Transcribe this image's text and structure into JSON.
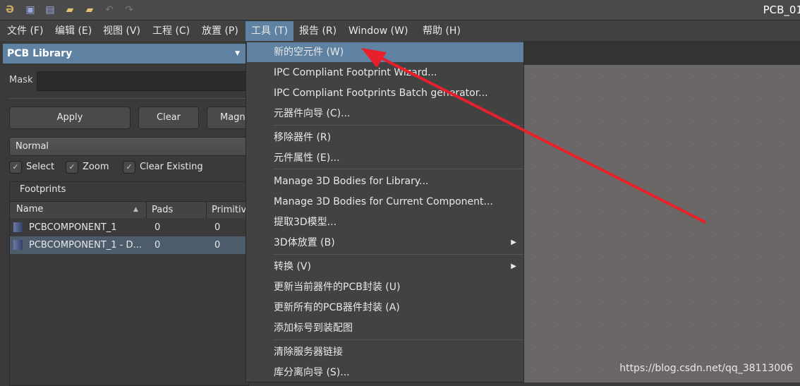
{
  "titlebar": {
    "title": "PCB_01",
    "icons": [
      "app-logo-icon",
      "save-icon",
      "save-all-icon",
      "open-icon",
      "open-project-icon",
      "undo-icon",
      "redo-icon"
    ]
  },
  "menubar": [
    "文件 (F)",
    "编辑 (E)",
    "视图 (V)",
    "工程 (C)",
    "放置 (P)",
    "工具 (T)",
    "报告 (R)",
    "Window (W)",
    "帮助 (H)"
  ],
  "panel": {
    "title": "PCB Library",
    "mask_label": "Mask",
    "mask_value": "",
    "buttons": {
      "apply": "Apply",
      "clear": "Clear",
      "magnify": "Magn"
    },
    "mode": "Normal",
    "checkboxes": [
      {
        "label": "Select",
        "checked": true
      },
      {
        "label": "Zoom",
        "checked": true
      },
      {
        "label": "Clear Existing",
        "checked": true
      }
    ],
    "footprints": {
      "title": "Footprints",
      "columns": [
        "Name",
        "Pads",
        "Primitive"
      ],
      "rows": [
        {
          "name": "PCBCOMPONENT_1",
          "pads": "0",
          "primitives": "0"
        },
        {
          "name": "PCBCOMPONENT_1 - D...",
          "pads": "0",
          "primitives": "0",
          "selected": true
        }
      ]
    }
  },
  "tools_menu": {
    "items": [
      "新的空元件 (W)",
      "IPC Compliant Footprint Wizard...",
      "IPC Compliant Footprints Batch generator...",
      "元器件向导 (C)...",
      "移除器件 (R)",
      "元件属性 (E)...",
      "Manage 3D Bodies for Library...",
      "Manage 3D Bodies for Current Component...",
      "提取3D模型...",
      "3D体放置 (B)",
      "转换 (V)",
      "更新当前器件的PCB封装 (U)",
      "更新所有的PCB器件封装 (A)",
      "添加标号到装配图",
      "清除服务器链接",
      "库分离向导 (S)..."
    ],
    "highlighted": 0
  },
  "annotation": {
    "arrow_color": "#e8202a"
  },
  "watermark": "https://blog.csdn.net/qq_38113006"
}
